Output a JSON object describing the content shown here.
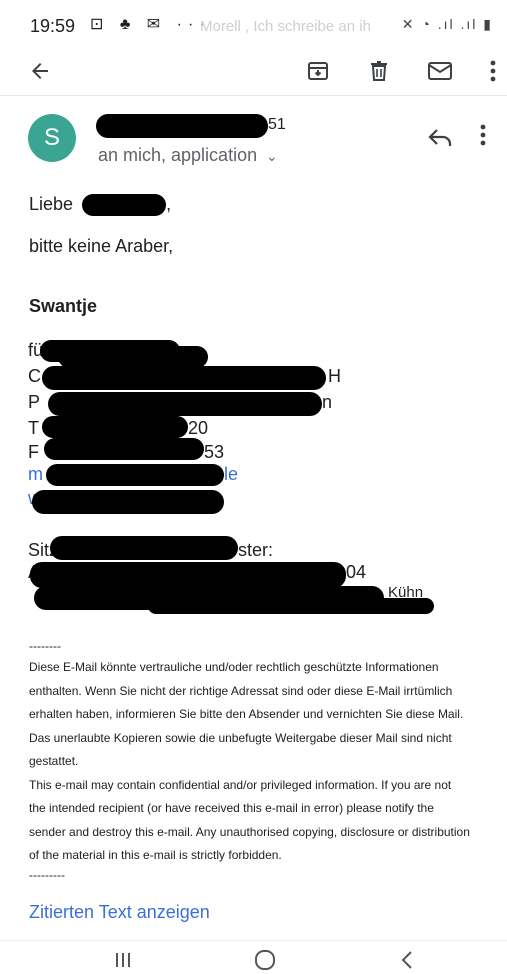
{
  "status_bar": {
    "time": "19:59",
    "ghost_text_1": "",
    "ghost_text_2": "Morell , Ich schreibe an ih"
  },
  "email": {
    "sender_initial": "S",
    "sender_name_tail": "51",
    "recipients": "an mich, application",
    "greeting": "Liebe",
    "body_line": "bitte keine Araber,",
    "signature_name": "Swantje",
    "signature_peeks": {
      "p1": "fü",
      "p2": "C",
      "p3": "H",
      "p4": "P",
      "p5": "n",
      "p6": "T",
      "p7": "20",
      "p8": "F",
      "p9": "53",
      "p10": "m",
      "p11": "le",
      "p12": "ww",
      "p13": "Sitz:",
      "p14": "ster:",
      "p15": "Am",
      "p16": "04",
      "p17": "Kühn"
    },
    "disclaimer": {
      "sep_top": "--------",
      "de_1": "Diese E-Mail könnte vertrauliche und/oder rechtlich geschützte Informationen",
      "de_2": "enthalten. Wenn Sie nicht der richtige Adressat sind oder diese E-Mail irrtümlich",
      "de_3": "erhalten haben, informieren Sie bitte den Absender und vernichten Sie diese Mail.",
      "de_4": "Das unerlaubte Kopieren sowie die unbefugte Weitergabe dieser Mail sind nicht",
      "de_5": "gestattet.",
      "en_1": "This e-mail may contain confidential and/or privileged information. If you are not",
      "en_2": "the intended recipient (or have received this e-mail in error) please notify the",
      "en_3": "sender and destroy this e-mail. Any unauthorised copying, disclosure or distribution",
      "en_4": "of the material in this e-mail is strictly forbidden.",
      "sep_bottom": "---------"
    },
    "quoted_link": "Zitierten Text anzeigen"
  },
  "colors": {
    "avatar": "#3aa592",
    "link": "#3b6fd8"
  },
  "icons": [
    "back-arrow-icon",
    "archive-icon",
    "trash-icon",
    "mail-icon",
    "more-vert-icon",
    "reply-icon"
  ]
}
